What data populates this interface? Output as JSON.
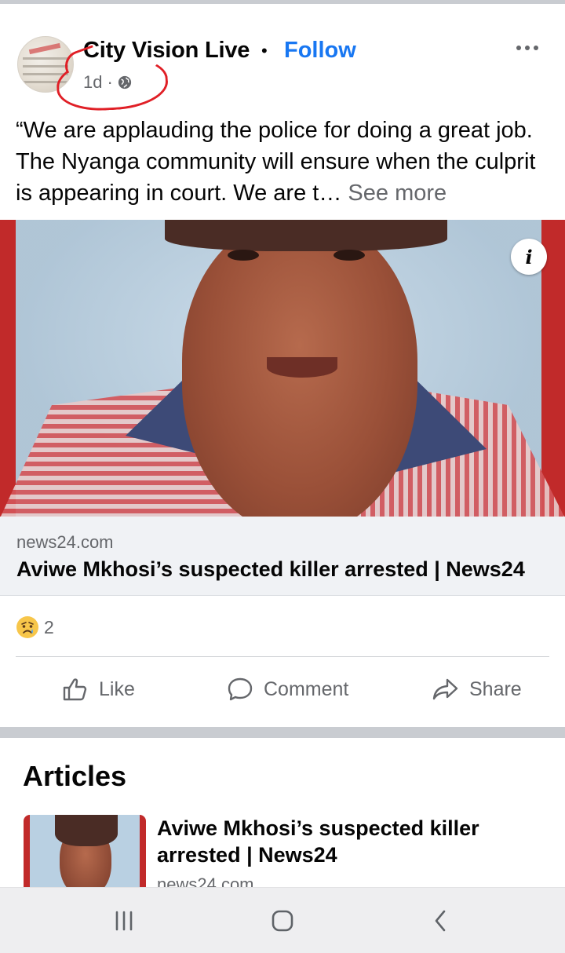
{
  "post": {
    "page_name": "City Vision Live",
    "separator": "•",
    "follow_label": "Follow",
    "time": "1d",
    "meta_separator": "·",
    "text": "“We are applauding the police for doing a great job. The Nyanga community will ensure when the culprit is appearing in court. We are t…",
    "see_more": "See more",
    "info_icon_glyph": "i"
  },
  "link_preview": {
    "domain": "news24.com",
    "title": "Aviwe Mkhosi’s suspected killer arrested | News24"
  },
  "reactions": {
    "icon": "sad-emoji-icon",
    "count": "2"
  },
  "actions": {
    "like_label": "Like",
    "comment_label": "Comment",
    "share_label": "Share"
  },
  "articles": {
    "heading": "Articles",
    "items": [
      {
        "title": "Aviwe Mkhosi’s suspected killer arrested | News24",
        "domain": "news24.com"
      }
    ]
  },
  "navbar": {
    "icons": [
      "recent-apps-icon",
      "home-icon",
      "back-icon"
    ]
  },
  "colors": {
    "accent": "#1877f2",
    "annotation": "#e01f26",
    "secondary_text": "#65676b"
  }
}
